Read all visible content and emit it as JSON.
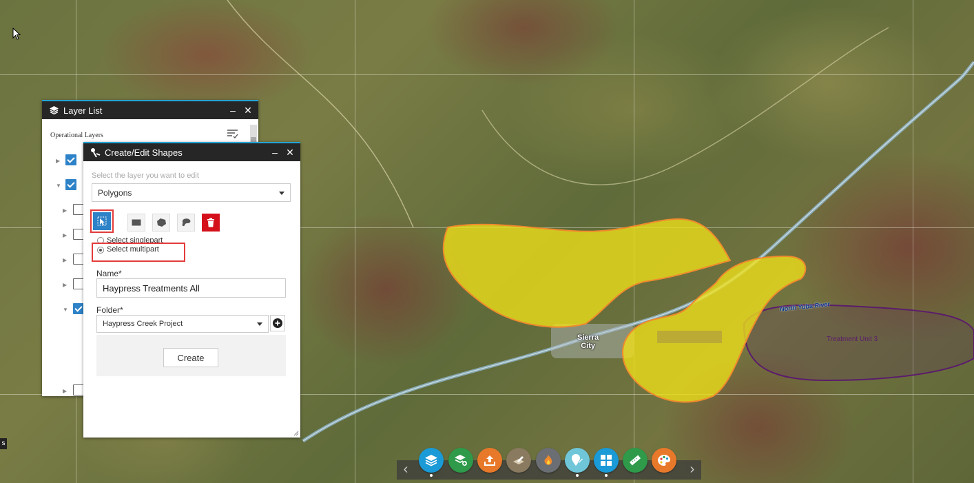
{
  "map": {
    "place_label": "Sierra\nCity",
    "river_label": "North Yuba River",
    "polygon_label": "Treatment Unit 3",
    "colors": {
      "polygon_fill": "#f0e01a",
      "polygon_stroke": "#f08a2c",
      "polygon2_stroke": "#5b1c6b",
      "highlight_box": "#e33b3b"
    }
  },
  "layer_list": {
    "title": "Layer List",
    "section_label": "Operational Layers",
    "minimize_label": "–",
    "close_label": "✕",
    "rows": [
      {
        "checked": true,
        "expanded": false
      },
      {
        "checked": true,
        "expanded": true
      },
      {
        "checked": false,
        "expanded": false
      },
      {
        "checked": false,
        "expanded": false
      },
      {
        "checked": false,
        "expanded": false
      },
      {
        "checked": false,
        "expanded": false
      },
      {
        "checked": true,
        "expanded": true
      },
      {
        "checked": false,
        "expanded": false
      }
    ]
  },
  "edit_shapes": {
    "title": "Create/Edit Shapes",
    "minimize_label": "–",
    "close_label": "✕",
    "layer_prompt": "Select the layer you want to edit",
    "layer_selected": "Polygons",
    "tools": [
      "select-tool-icon",
      "rectangle-icon",
      "polygon-icon",
      "freehand-polygon-icon",
      "delete-icon"
    ],
    "radio_singlepart": "Select singlepart",
    "radio_multipart": "Select multipart",
    "radio_selected": "multipart",
    "name_label": "Name*",
    "name_value": "Haypress Treatments All",
    "folder_label": "Folder*",
    "folder_selected": "Haypress Creek Project",
    "create_label": "Create"
  },
  "bottom_toolbar": {
    "prev_label": "‹",
    "next_label": "›",
    "buttons": [
      {
        "icon": "layers-icon",
        "color": "#1a9ad6",
        "active": true
      },
      {
        "icon": "add-layer-icon",
        "color": "#2e9a4a",
        "active": false
      },
      {
        "icon": "upload-icon",
        "color": "#e8792a",
        "active": false
      },
      {
        "icon": "edit-icon",
        "color": "#8a7a60",
        "active": false
      },
      {
        "icon": "fire-icon",
        "color": "#6b6e73",
        "active": false
      },
      {
        "icon": "location-edit-icon",
        "color": "#6fc6d9",
        "active": true
      },
      {
        "icon": "grid-icon",
        "color": "#1a9ad6",
        "active": true
      },
      {
        "icon": "measure-icon",
        "color": "#2e9a4a",
        "active": false
      },
      {
        "icon": "palette-icon",
        "color": "#e8792a",
        "active": false
      }
    ]
  },
  "left_edge_label": "s"
}
